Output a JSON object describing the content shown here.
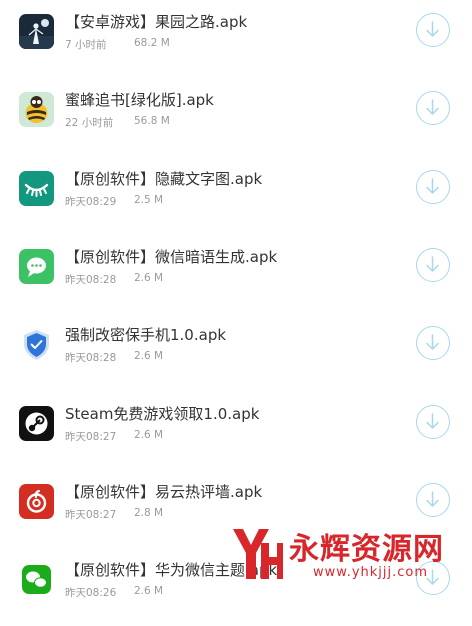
{
  "files": [
    {
      "name": "【安卓游戏】果园之路.apk",
      "time": "7 小时前",
      "size": "68.2 M",
      "icon": "game-girl-icon"
    },
    {
      "name": "蜜蜂追书[绿化版].apk",
      "time": "22 小时前",
      "size": "56.8 M",
      "icon": "bee-reader-icon"
    },
    {
      "name": "【原创软件】隐藏文字图.apk",
      "time": "昨天08:29",
      "size": "2.5 M",
      "icon": "eye-closed-icon"
    },
    {
      "name": "【原创软件】微信暗语生成.apk",
      "time": "昨天08:28",
      "size": "2.6 M",
      "icon": "chat-bubble-icon"
    },
    {
      "name": "强制改密保手机1.0.apk",
      "time": "昨天08:28",
      "size": "2.6 M",
      "icon": "shield-icon"
    },
    {
      "name": "Steam免费游戏领取1.0.apk",
      "time": "昨天08:27",
      "size": "2.6 M",
      "icon": "steam-icon"
    },
    {
      "name": "【原创软件】易云热评墙.apk",
      "time": "昨天08:27",
      "size": "2.8 M",
      "icon": "netease-music-icon"
    },
    {
      "name": "【原创软件】华为微信主题.apk",
      "time": "昨天08:26",
      "size": "2.6 M",
      "icon": "wechat-icon"
    }
  ],
  "watermark": {
    "text": "永辉资源网",
    "url": "www.yhkjjj.com"
  },
  "colors": {
    "download_ring": "#a6d8ee",
    "name_text": "#333333",
    "meta_text": "#9a9a9a",
    "watermark_red": "#d8262a"
  }
}
